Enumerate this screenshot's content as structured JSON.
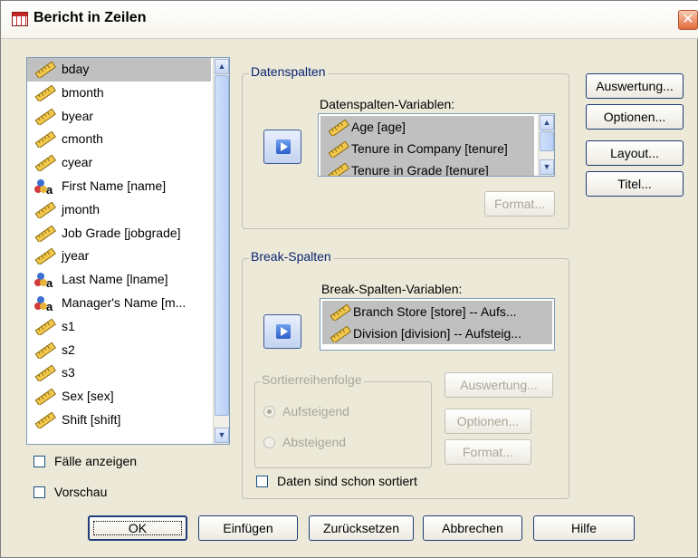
{
  "window": {
    "title": "Bericht in Zeilen",
    "close_glyph": "✕"
  },
  "source_list": {
    "items": [
      {
        "label": "bday",
        "icon": "scale-icon",
        "selected": true
      },
      {
        "label": "bmonth",
        "icon": "scale-icon"
      },
      {
        "label": "byear",
        "icon": "scale-icon"
      },
      {
        "label": "cmonth",
        "icon": "scale-icon"
      },
      {
        "label": "cyear",
        "icon": "scale-icon"
      },
      {
        "label": "First Name [name]",
        "icon": "nominal-string-icon"
      },
      {
        "label": "jmonth",
        "icon": "scale-icon"
      },
      {
        "label": "Job Grade [jobgrade]",
        "icon": "scale-icon"
      },
      {
        "label": "jyear",
        "icon": "scale-icon"
      },
      {
        "label": "Last Name [lname]",
        "icon": "nominal-string-icon"
      },
      {
        "label": "Manager's Name [m...",
        "icon": "nominal-string-icon"
      },
      {
        "label": "s1",
        "icon": "scale-icon"
      },
      {
        "label": "s2",
        "icon": "scale-icon"
      },
      {
        "label": "s3",
        "icon": "scale-icon"
      },
      {
        "label": "Sex [sex]",
        "icon": "scale-icon"
      },
      {
        "label": "Shift [shift]",
        "icon": "scale-icon"
      }
    ]
  },
  "options": {
    "show_cases": "Fälle anzeigen",
    "preview": "Vorschau"
  },
  "data_columns": {
    "group_label": "Datenspalten",
    "list_label": "Datenspalten-Variablen:",
    "items": [
      "Age [age]",
      "Tenure in Company [tenure]",
      "Tenure in Grade [tenure]"
    ],
    "format_button": "Format..."
  },
  "break_columns": {
    "group_label": "Break-Spalten",
    "list_label": "Break-Spalten-Variablen:",
    "items": [
      "Branch Store [store] -- Aufs...",
      "Division [division] -- Aufsteig..."
    ],
    "sort_group_label": "Sortierreihenfolge",
    "ascending": "Aufsteigend",
    "descending": "Absteigend",
    "summary_button": "Auswertung...",
    "options_button": "Optionen...",
    "format_button": "Format...",
    "presorted": "Daten sind schon sortiert"
  },
  "side_buttons": {
    "summary": "Auswertung...",
    "options": "Optionen...",
    "layout": "Layout...",
    "titles": "Titel..."
  },
  "footer": {
    "ok": "OK",
    "paste": "Einfügen",
    "reset": "Zurücksetzen",
    "cancel": "Abbrechen",
    "help": "Hilfe"
  },
  "colors": {
    "dialog_bg": "#ece9d8",
    "selection": "#c0c0c0",
    "disabled_text": "#a9a797",
    "group_label": "#0a2472"
  }
}
